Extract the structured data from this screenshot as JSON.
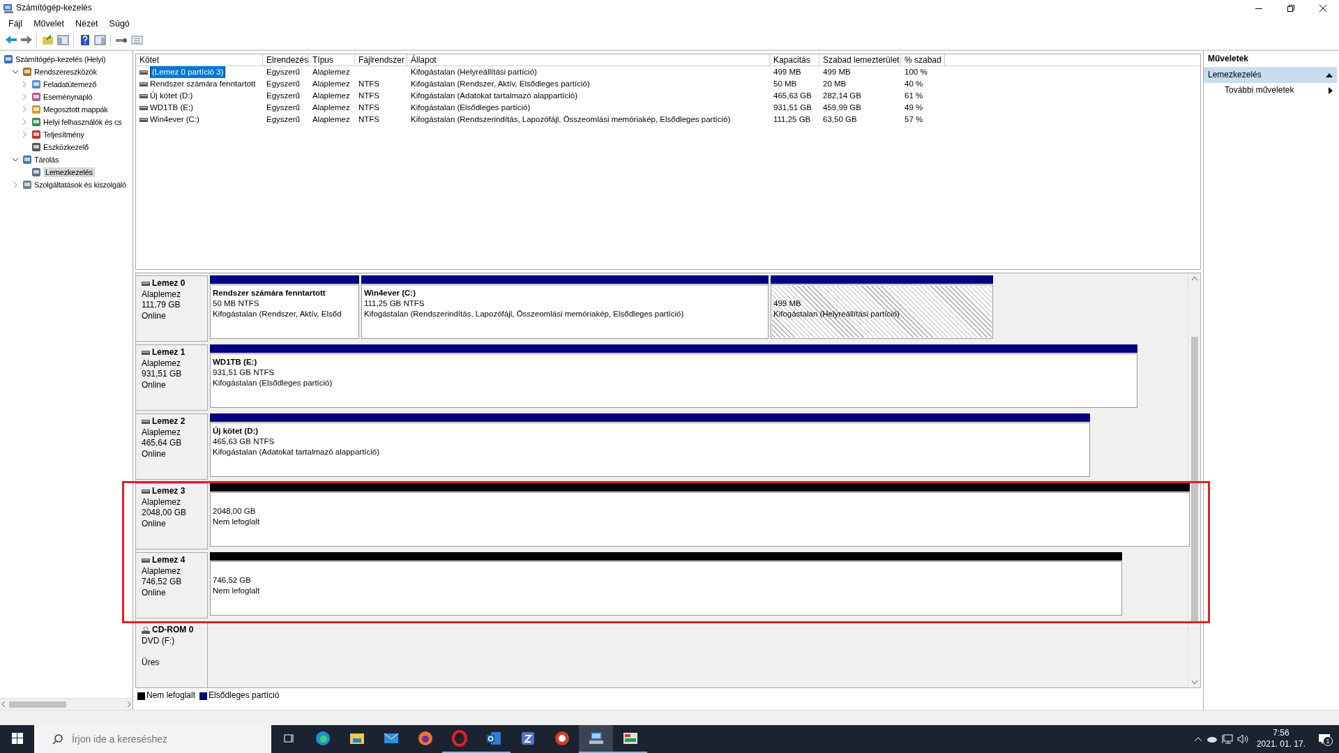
{
  "window": {
    "title": "Számítógép-kezelés"
  },
  "menu": [
    "Fájl",
    "Művelet",
    "Nézet",
    "Súgó"
  ],
  "tree": [
    {
      "label": "Számítógép-kezelés (Helyi)",
      "selected": false,
      "children": [
        {
          "label": "Rendszereszközök",
          "expanded": true,
          "selected": false,
          "children": [
            {
              "label": "Feladatütemező",
              "expanded": false,
              "selected": false
            },
            {
              "label": "Eseménynapló",
              "expanded": false,
              "selected": false
            },
            {
              "label": "Megosztott mappák",
              "expanded": false,
              "selected": false
            },
            {
              "label": "Helyi felhasználók és cs",
              "expanded": false,
              "selected": false
            },
            {
              "label": "Teljesítmény",
              "expanded": false,
              "selected": false
            },
            {
              "label": "Eszközkezelő",
              "selected": false
            }
          ]
        },
        {
          "label": "Tárolás",
          "expanded": true,
          "selected": false,
          "children": [
            {
              "label": "Lemezkezelés",
              "selected": true
            }
          ]
        },
        {
          "label": "Szolgáltatások és kiszolgáló",
          "expanded": false,
          "selected": false
        }
      ]
    }
  ],
  "table": {
    "columns": [
      "Kötet",
      "Elrendezés",
      "Típus",
      "Fájlrendszer",
      "Állapot",
      "Kapacitás",
      "Szabad lemezterület",
      "% szabad"
    ],
    "rows": [
      {
        "selected": true,
        "cells": [
          "(Lemez 0 partíció 3)",
          "Egyszerű",
          "Alaplemez",
          "",
          "Kifogástalan (Helyreállítási partíció)",
          "499 MB",
          "499 MB",
          "100 %"
        ]
      },
      {
        "selected": false,
        "cells": [
          "Rendszer számára fenntartott",
          "Egyszerű",
          "Alaplemez",
          "NTFS",
          "Kifogástalan (Rendszer, Aktív, Elsődleges partíció)",
          "50 MB",
          "20 MB",
          "40 %"
        ]
      },
      {
        "selected": false,
        "cells": [
          "Új kötet (D:)",
          "Egyszerű",
          "Alaplemez",
          "NTFS",
          "Kifogástalan (Adatokat tartalmazó alappartíció)",
          "465,63 GB",
          "282,14 GB",
          "61 %"
        ]
      },
      {
        "selected": false,
        "cells": [
          "WD1TB (E:)",
          "Egyszerű",
          "Alaplemez",
          "NTFS",
          "Kifogástalan (Elsődleges partíció)",
          "931,51 GB",
          "459,99 GB",
          "49 %"
        ]
      },
      {
        "selected": false,
        "cells": [
          "Win4ever (C:)",
          "Egyszerű",
          "Alaplemez",
          "NTFS",
          "Kifogástalan (Rendszerindítás, Lapozófájl, Összeomlási memóriakép, Elsődleges partíció)",
          "111,25 GB",
          "63,50 GB",
          "57 %"
        ]
      }
    ]
  },
  "disks": [
    {
      "kind": "disk",
      "name": "Lemez 0",
      "type": "Alaplemez",
      "size": "111,79 GB",
      "status": "Online",
      "highlighted": false,
      "partitions": [
        {
          "kind": "primary",
          "selected": false,
          "title": "Rendszer számára fenntartott",
          "detail": "50 MB NTFS",
          "status": "Kifogástalan (Rendszer, Aktív, Elsőd"
        },
        {
          "kind": "primary",
          "selected": false,
          "title": "Win4ever  (C:)",
          "detail": "111,25 GB NTFS",
          "status": "Kifogástalan (Rendszerindítás, Lapozófájl, Összeomlási memóriakép, Elsődleges partíció)"
        },
        {
          "kind": "primary",
          "selected": true,
          "detail": "499 MB",
          "status": "Kifogástalan (Helyreállítási partíció)"
        }
      ]
    },
    {
      "kind": "disk",
      "name": "Lemez 1",
      "type": "Alaplemez",
      "size": "931,51 GB",
      "status": "Online",
      "highlighted": false,
      "partitions": [
        {
          "kind": "primary",
          "selected": false,
          "title": "WD1TB  (E:)",
          "detail": "931,51 GB NTFS",
          "status": "Kifogástalan (Elsődleges partíció)"
        }
      ]
    },
    {
      "kind": "disk",
      "name": "Lemez 2",
      "type": "Alaplemez",
      "size": "465,64 GB",
      "status": "Online",
      "highlighted": false,
      "partitions": [
        {
          "kind": "primary",
          "selected": false,
          "title": "Új kötet  (D:)",
          "detail": "465,63 GB NTFS",
          "status": "Kifogástalan (Adatokat tartalmazó alappartíció)"
        }
      ]
    },
    {
      "kind": "disk",
      "name": "Lemez 3",
      "type": "Alaplemez",
      "size": "2048,00 GB",
      "status": "Online",
      "highlighted": true,
      "partitions": [
        {
          "kind": "unallocated",
          "selected": false,
          "detail": "2048,00 GB",
          "status": "Nem lefoglalt"
        }
      ]
    },
    {
      "kind": "disk",
      "name": "Lemez 4",
      "type": "Alaplemez",
      "size": "746,52 GB",
      "status": "Online",
      "highlighted": true,
      "partitions": [
        {
          "kind": "unallocated",
          "selected": false,
          "detail": "746,52 GB",
          "status": "Nem lefoglalt"
        }
      ]
    },
    {
      "kind": "cdrom",
      "name": "CD-ROM 0",
      "type": "DVD (F:)",
      "status": "Üres",
      "highlighted": false
    }
  ],
  "legend": [
    {
      "label": "Nem lefoglalt",
      "color": "#000000"
    },
    {
      "label": "Elsődleges partíció",
      "color": "#000080"
    }
  ],
  "actions": {
    "title": "Műveletek",
    "section": "Lemezkezelés",
    "items": [
      "További műveletek"
    ]
  },
  "taskbar": {
    "search_placeholder": "Írjon ide a kereséshez",
    "apps": [
      {
        "selected": false,
        "running": false
      },
      {
        "selected": false,
        "running": false
      },
      {
        "selected": false,
        "running": false
      },
      {
        "selected": false,
        "running": false
      },
      {
        "selected": false,
        "running": true
      },
      {
        "selected": false,
        "running": true
      },
      {
        "selected": false,
        "running": false
      },
      {
        "selected": false,
        "running": false
      },
      {
        "selected": true,
        "running": true
      },
      {
        "selected": false,
        "running": true
      }
    ],
    "time": "7:56",
    "date": "2021. 01. 17.",
    "notifications": "1"
  }
}
